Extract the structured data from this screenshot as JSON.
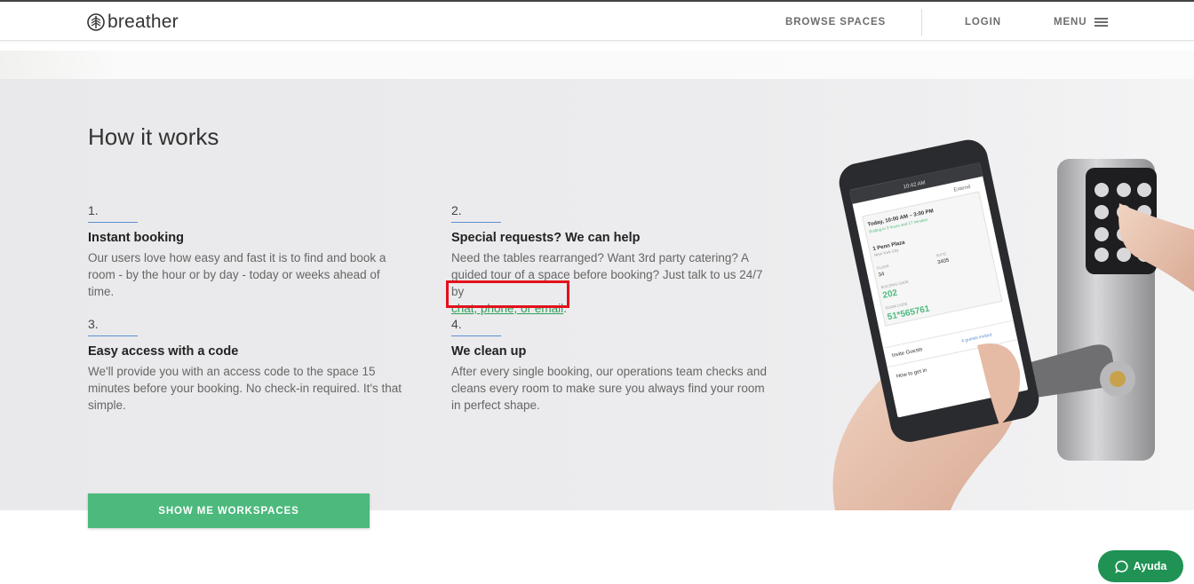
{
  "header": {
    "logo_text": "breather",
    "nav": {
      "browse_spaces": "BROWSE SPACES",
      "login": "LOGIN",
      "menu": "MENU"
    }
  },
  "how_it_works": {
    "title": "How it works",
    "steps": [
      {
        "number": "1.",
        "title": "Instant booking",
        "text": "Our users love how easy and fast it is to find and book a room - by the hour or by day - today or weeks ahead of time."
      },
      {
        "number": "2.",
        "title": "Special requests? We can help",
        "text": "Need the tables rearranged? Want 3rd party catering? A guided tour of a space before booking? Just talk to us 24/7 by",
        "link": "chat, phone, or email",
        "after_link": "."
      },
      {
        "number": "3.",
        "title": "Easy access with a code",
        "text": "We'll provide you with an access code to the space 15 minutes before your booking. No check-in required. It's that simple."
      },
      {
        "number": "4.",
        "title": "We clean up",
        "text": "After every single booking, our operations team checks and cleans every room to make sure you always find your room in perfect shape."
      }
    ],
    "cta": "SHOW ME WORKSPACES"
  },
  "phone_screen": {
    "status_time": "10:42 AM",
    "tab": "Extend",
    "booking_time": "Today, 10:00 AM – 3:00 PM",
    "booking_sub": "Ending in 3 hours and 17 minutes",
    "place": "1 Penn Plaza",
    "city": "New York City",
    "floor_label": "FLOOR",
    "floor_value": "34",
    "suite_label": "SUITE",
    "suite_value": "3405",
    "building_code_label": "BUILDING CODE",
    "building_code_value": "202",
    "room_code_label": "ROOM CODE",
    "room_code_value": "51*565761",
    "invite_label": "Invite Guests",
    "invite_status": "4 guests invited",
    "how_to_get_in": "How to get in"
  },
  "chat_widget": {
    "label": "Ayuda"
  },
  "colors": {
    "accent_green": "#4cb97d",
    "chat_green": "#1f9254",
    "link_green": "#2f9e5b",
    "highlight_red": "#e3111c",
    "rule_blue": "#5b8ed1"
  },
  "icons": [
    "breather-logo-icon",
    "hamburger-icon",
    "chat-bubble-icon"
  ]
}
